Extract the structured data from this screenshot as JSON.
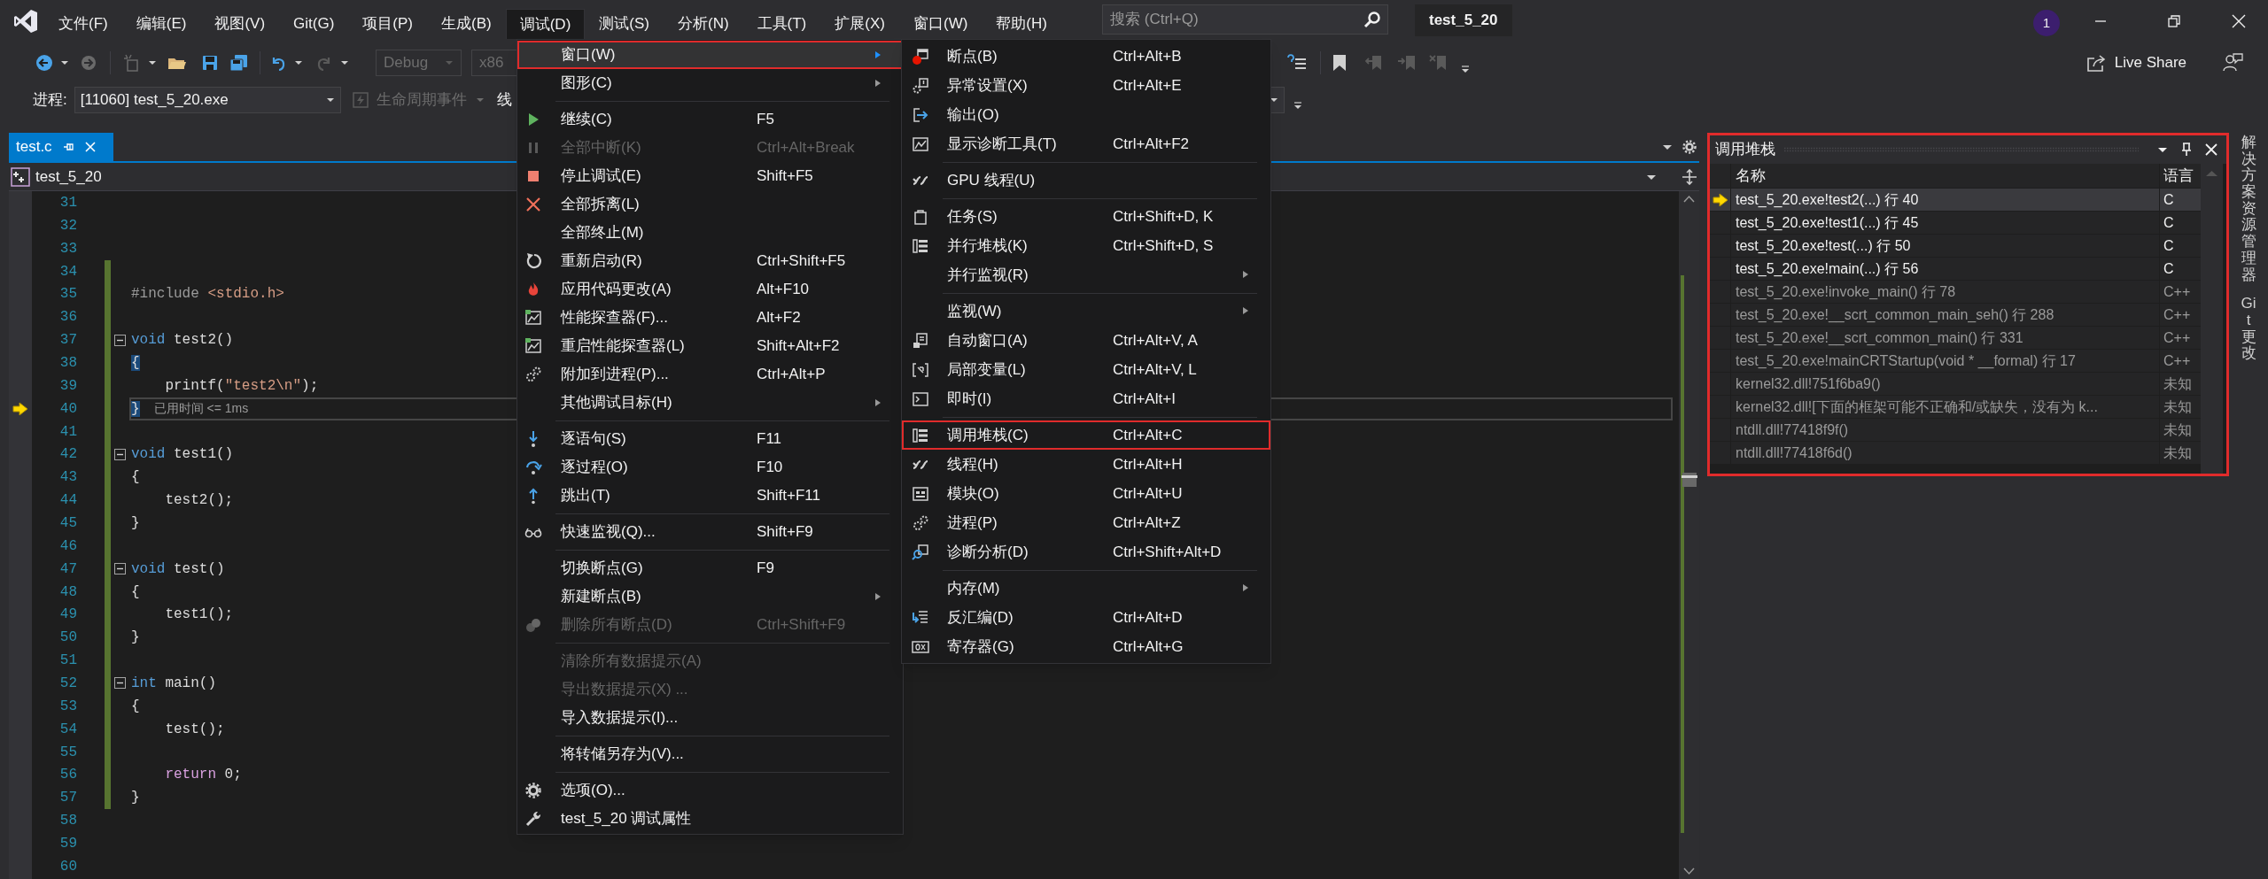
{
  "menu_bar": [
    {
      "label": "文件(F)",
      "selected": false
    },
    {
      "label": "编辑(E)",
      "selected": false
    },
    {
      "label": "视图(V)",
      "selected": false
    },
    {
      "label": "Git(G)",
      "selected": false
    },
    {
      "label": "项目(P)",
      "selected": false
    },
    {
      "label": "生成(B)",
      "selected": false
    },
    {
      "label": "调试(D)",
      "selected": true
    },
    {
      "label": "测试(S)",
      "selected": false
    },
    {
      "label": "分析(N)",
      "selected": false
    },
    {
      "label": "工具(T)",
      "selected": false
    },
    {
      "label": "扩展(X)",
      "selected": false
    },
    {
      "label": "窗口(W)",
      "selected": false
    },
    {
      "label": "帮助(H)",
      "selected": false
    }
  ],
  "search": {
    "placeholder": "搜索 (Ctrl+Q)"
  },
  "window_title": "test_5_20",
  "notification_count": "1",
  "toolbar": {
    "dropdowns": [
      {
        "value": "Debug",
        "disabled": true
      },
      {
        "value": "x86",
        "disabled": true
      }
    ],
    "live_share": "Live Share"
  },
  "process_bar": {
    "label": "进程:",
    "process": "[11060] test_5_20.exe",
    "lifecycle_events": {
      "label": "生命周期事件",
      "disabled": true
    },
    "thread_label": "线"
  },
  "document_tab": {
    "label": "test.c",
    "selected": true
  },
  "breadcrumb": "test_5_20",
  "editor": {
    "lines": [
      {
        "number": "31",
        "changed": false,
        "fold": false,
        "current": false
      },
      {
        "number": "32",
        "changed": false,
        "fold": false,
        "current": false
      },
      {
        "number": "33",
        "changed": false,
        "fold": false,
        "current": false
      },
      {
        "number": "34",
        "changed": true,
        "fold": false,
        "current": false
      },
      {
        "number": "35",
        "changed": true,
        "fold": false,
        "current": false,
        "tokens": [
          {
            "kind": "preprocessor",
            "text": "#include "
          },
          {
            "kind": "include",
            "text": "<stdio.h>"
          }
        ]
      },
      {
        "number": "36",
        "changed": true,
        "fold": false,
        "current": false
      },
      {
        "number": "37",
        "changed": true,
        "fold": true,
        "current": false,
        "tokens": [
          {
            "kind": "keyword",
            "text": "void"
          },
          {
            "kind": "plain",
            "text": " test2()"
          }
        ]
      },
      {
        "number": "38",
        "changed": true,
        "fold": false,
        "current": false,
        "tokens": [
          {
            "kind": "brace_match",
            "text": "{"
          }
        ]
      },
      {
        "number": "39",
        "changed": true,
        "fold": false,
        "current": false,
        "tokens": [
          {
            "kind": "plain",
            "text": "    printf("
          },
          {
            "kind": "string",
            "text": "\"test2\\n\""
          },
          {
            "kind": "plain",
            "text": ");"
          }
        ]
      },
      {
        "number": "40",
        "changed": true,
        "fold": false,
        "current": true,
        "tokens": [
          {
            "kind": "brace_match",
            "text": "}"
          }
        ],
        "tip": "已用时间 <= 1ms"
      },
      {
        "number": "41",
        "changed": true,
        "fold": false,
        "current": false
      },
      {
        "number": "42",
        "changed": true,
        "fold": true,
        "current": false,
        "tokens": [
          {
            "kind": "keyword",
            "text": "void"
          },
          {
            "kind": "plain",
            "text": " test1()"
          }
        ]
      },
      {
        "number": "43",
        "changed": true,
        "fold": false,
        "current": false,
        "tokens": [
          {
            "kind": "plain",
            "text": "{"
          }
        ]
      },
      {
        "number": "44",
        "changed": true,
        "fold": false,
        "current": false,
        "tokens": [
          {
            "kind": "plain",
            "text": "    test2();"
          }
        ]
      },
      {
        "number": "45",
        "changed": true,
        "fold": false,
        "current": false,
        "tokens": [
          {
            "kind": "plain",
            "text": "}"
          }
        ]
      },
      {
        "number": "46",
        "changed": true,
        "fold": false,
        "current": false
      },
      {
        "number": "47",
        "changed": true,
        "fold": true,
        "current": false,
        "tokens": [
          {
            "kind": "keyword",
            "text": "void"
          },
          {
            "kind": "plain",
            "text": " test()"
          }
        ]
      },
      {
        "number": "48",
        "changed": true,
        "fold": false,
        "current": false,
        "tokens": [
          {
            "kind": "plain",
            "text": "{"
          }
        ]
      },
      {
        "number": "49",
        "changed": true,
        "fold": false,
        "current": false,
        "tokens": [
          {
            "kind": "plain",
            "text": "    test1();"
          }
        ]
      },
      {
        "number": "50",
        "changed": true,
        "fold": false,
        "current": false,
        "tokens": [
          {
            "kind": "plain",
            "text": "}"
          }
        ]
      },
      {
        "number": "51",
        "changed": true,
        "fold": false,
        "current": false
      },
      {
        "number": "52",
        "changed": true,
        "fold": true,
        "current": false,
        "tokens": [
          {
            "kind": "keyword",
            "text": "int"
          },
          {
            "kind": "plain",
            "text": " main()"
          }
        ]
      },
      {
        "number": "53",
        "changed": true,
        "fold": false,
        "current": false,
        "tokens": [
          {
            "kind": "plain",
            "text": "{"
          }
        ]
      },
      {
        "number": "54",
        "changed": true,
        "fold": false,
        "current": false,
        "tokens": [
          {
            "kind": "plain",
            "text": "    test();"
          }
        ]
      },
      {
        "number": "55",
        "changed": true,
        "fold": false,
        "current": false
      },
      {
        "number": "56",
        "changed": true,
        "fold": false,
        "current": false,
        "tokens": [
          {
            "kind": "control",
            "text": "    return"
          },
          {
            "kind": "plain",
            "text": " 0;"
          }
        ]
      },
      {
        "number": "57",
        "changed": true,
        "fold": false,
        "current": false,
        "tokens": [
          {
            "kind": "plain",
            "text": "}"
          }
        ]
      },
      {
        "number": "58",
        "changed": false,
        "fold": false,
        "current": false
      },
      {
        "number": "59",
        "changed": false,
        "fold": false,
        "current": false
      },
      {
        "number": "60",
        "changed": false,
        "fold": false,
        "current": false
      }
    ]
  },
  "debug_menu": {
    "items": [
      {
        "kind": "item",
        "label": "窗口(W)",
        "submenu": true,
        "disabled": false,
        "selected": true,
        "highlighted": true
      },
      {
        "kind": "item",
        "label": "图形(C)",
        "submenu": true,
        "disabled": false,
        "selected": false,
        "highlighted": false
      },
      {
        "kind": "separator"
      },
      {
        "kind": "item",
        "label": "继续(C)",
        "shortcut": "F5",
        "submenu": false,
        "disabled": false,
        "selected": false,
        "highlighted": false
      },
      {
        "kind": "item",
        "label": "全部中断(K)",
        "shortcut": "Ctrl+Alt+Break",
        "submenu": false,
        "disabled": true,
        "selected": false,
        "highlighted": false
      },
      {
        "kind": "item",
        "label": "停止调试(E)",
        "shortcut": "Shift+F5",
        "submenu": false,
        "disabled": false,
        "selected": false,
        "highlighted": false
      },
      {
        "kind": "item",
        "label": "全部拆离(L)",
        "submenu": false,
        "disabled": false,
        "selected": false,
        "highlighted": false
      },
      {
        "kind": "item",
        "label": "全部终止(M)",
        "submenu": false,
        "disabled": false,
        "selected": false,
        "highlighted": false
      },
      {
        "kind": "item",
        "label": "重新启动(R)",
        "shortcut": "Ctrl+Shift+F5",
        "submenu": false,
        "disabled": false,
        "selected": false,
        "highlighted": false
      },
      {
        "kind": "item",
        "label": "应用代码更改(A)",
        "shortcut": "Alt+F10",
        "submenu": false,
        "disabled": false,
        "selected": false,
        "highlighted": false
      },
      {
        "kind": "item",
        "label": "性能探查器(F)...",
        "shortcut": "Alt+F2",
        "submenu": false,
        "disabled": false,
        "selected": false,
        "highlighted": false
      },
      {
        "kind": "item",
        "label": "重启性能探查器(L)",
        "shortcut": "Shift+Alt+F2",
        "submenu": false,
        "disabled": false,
        "selected": false,
        "highlighted": false
      },
      {
        "kind": "item",
        "label": "附加到进程(P)...",
        "shortcut": "Ctrl+Alt+P",
        "submenu": false,
        "disabled": false,
        "selected": false,
        "highlighted": false
      },
      {
        "kind": "item",
        "label": "其他调试目标(H)",
        "submenu": true,
        "disabled": false,
        "selected": false,
        "highlighted": false
      },
      {
        "kind": "separator"
      },
      {
        "kind": "item",
        "label": "逐语句(S)",
        "shortcut": "F11",
        "submenu": false,
        "disabled": false,
        "selected": false,
        "highlighted": false
      },
      {
        "kind": "item",
        "label": "逐过程(O)",
        "shortcut": "F10",
        "submenu": false,
        "disabled": false,
        "selected": false,
        "highlighted": false
      },
      {
        "kind": "item",
        "label": "跳出(T)",
        "shortcut": "Shift+F11",
        "submenu": false,
        "disabled": false,
        "selected": false,
        "highlighted": false
      },
      {
        "kind": "separator"
      },
      {
        "kind": "item",
        "label": "快速监视(Q)...",
        "shortcut": "Shift+F9",
        "submenu": false,
        "disabled": false,
        "selected": false,
        "highlighted": false
      },
      {
        "kind": "separator"
      },
      {
        "kind": "item",
        "label": "切换断点(G)",
        "shortcut": "F9",
        "submenu": false,
        "disabled": false,
        "selected": false,
        "highlighted": false
      },
      {
        "kind": "item",
        "label": "新建断点(B)",
        "submenu": true,
        "disabled": false,
        "selected": false,
        "highlighted": false
      },
      {
        "kind": "item",
        "label": "删除所有断点(D)",
        "shortcut": "Ctrl+Shift+F9",
        "submenu": false,
        "disabled": true,
        "selected": false,
        "highlighted": false
      },
      {
        "kind": "separator"
      },
      {
        "kind": "item",
        "label": "清除所有数据提示(A)",
        "submenu": false,
        "disabled": true,
        "selected": false,
        "highlighted": false
      },
      {
        "kind": "item",
        "label": "导出数据提示(X) ...",
        "submenu": false,
        "disabled": true,
        "selected": false,
        "highlighted": false
      },
      {
        "kind": "item",
        "label": "导入数据提示(I)...",
        "submenu": false,
        "disabled": false,
        "selected": false,
        "highlighted": false
      },
      {
        "kind": "separator"
      },
      {
        "kind": "item",
        "label": "将转储另存为(V)...",
        "submenu": false,
        "disabled": false,
        "selected": false,
        "highlighted": false
      },
      {
        "kind": "separator"
      },
      {
        "kind": "item",
        "label": "选项(O)...",
        "submenu": false,
        "disabled": false,
        "selected": false,
        "highlighted": false
      },
      {
        "kind": "item",
        "label": "test_5_20 调试属性",
        "submenu": false,
        "disabled": false,
        "selected": false,
        "highlighted": false
      }
    ]
  },
  "window_submenu": {
    "items": [
      {
        "kind": "item",
        "label": "断点(B)",
        "shortcut": "Ctrl+Alt+B",
        "submenu": false,
        "highlighted": false
      },
      {
        "kind": "item",
        "label": "异常设置(X)",
        "shortcut": "Ctrl+Alt+E",
        "submenu": false,
        "highlighted": false
      },
      {
        "kind": "item",
        "label": "输出(O)",
        "submenu": false,
        "highlighted": false
      },
      {
        "kind": "item",
        "label": "显示诊断工具(T)",
        "shortcut": "Ctrl+Alt+F2",
        "submenu": false,
        "highlighted": false
      },
      {
        "kind": "separator"
      },
      {
        "kind": "item",
        "label": "GPU 线程(U)",
        "submenu": false,
        "highlighted": false
      },
      {
        "kind": "separator"
      },
      {
        "kind": "item",
        "label": "任务(S)",
        "shortcut": "Ctrl+Shift+D, K",
        "submenu": false,
        "highlighted": false
      },
      {
        "kind": "item",
        "label": "并行堆栈(K)",
        "shortcut": "Ctrl+Shift+D, S",
        "submenu": false,
        "highlighted": false
      },
      {
        "kind": "item",
        "label": "并行监视(R)",
        "submenu": true,
        "highlighted": false
      },
      {
        "kind": "separator"
      },
      {
        "kind": "item",
        "label": "监视(W)",
        "submenu": true,
        "highlighted": false
      },
      {
        "kind": "item",
        "label": "自动窗口(A)",
        "shortcut": "Ctrl+Alt+V, A",
        "submenu": false,
        "highlighted": false
      },
      {
        "kind": "item",
        "label": "局部变量(L)",
        "shortcut": "Ctrl+Alt+V, L",
        "submenu": false,
        "highlighted": false
      },
      {
        "kind": "item",
        "label": "即时(I)",
        "shortcut": "Ctrl+Alt+I",
        "submenu": false,
        "highlighted": false
      },
      {
        "kind": "separator"
      },
      {
        "kind": "item",
        "label": "调用堆栈(C)",
        "shortcut": "Ctrl+Alt+C",
        "submenu": false,
        "highlighted": true
      },
      {
        "kind": "item",
        "label": "线程(H)",
        "shortcut": "Ctrl+Alt+H",
        "submenu": false,
        "highlighted": false
      },
      {
        "kind": "item",
        "label": "模块(O)",
        "shortcut": "Ctrl+Alt+U",
        "submenu": false,
        "highlighted": false
      },
      {
        "kind": "item",
        "label": "进程(P)",
        "shortcut": "Ctrl+Alt+Z",
        "submenu": false,
        "highlighted": false
      },
      {
        "kind": "item",
        "label": "诊断分析(D)",
        "shortcut": "Ctrl+Shift+Alt+D",
        "submenu": false,
        "highlighted": false
      },
      {
        "kind": "separator"
      },
      {
        "kind": "item",
        "label": "内存(M)",
        "submenu": true,
        "highlighted": false
      },
      {
        "kind": "item",
        "label": "反汇编(D)",
        "shortcut": "Ctrl+Alt+D",
        "submenu": false,
        "highlighted": false
      },
      {
        "kind": "item",
        "label": "寄存器(G)",
        "shortcut": "Ctrl+Alt+G",
        "submenu": false,
        "highlighted": false
      }
    ]
  },
  "call_stack": {
    "title": "调用堆栈",
    "highlighted": true,
    "columns": [
      "名称",
      "语言"
    ],
    "rows": [
      {
        "name": "test_5_20.exe!test2(...) 行 40",
        "language": "C",
        "current": true,
        "dimmed": false
      },
      {
        "name": "test_5_20.exe!test1(...) 行 45",
        "language": "C",
        "current": false,
        "dimmed": false
      },
      {
        "name": "test_5_20.exe!test(...) 行 50",
        "language": "C",
        "current": false,
        "dimmed": false
      },
      {
        "name": "test_5_20.exe!main(...) 行 56",
        "language": "C",
        "current": false,
        "dimmed": false
      },
      {
        "name": "test_5_20.exe!invoke_main() 行 78",
        "language": "C++",
        "current": false,
        "dimmed": true
      },
      {
        "name": "test_5_20.exe!__scrt_common_main_seh() 行 288",
        "language": "C++",
        "current": false,
        "dimmed": true
      },
      {
        "name": "test_5_20.exe!__scrt_common_main() 行 331",
        "language": "C++",
        "current": false,
        "dimmed": true
      },
      {
        "name": "test_5_20.exe!mainCRTStartup(void * __formal) 行 17",
        "language": "C++",
        "current": false,
        "dimmed": true
      },
      {
        "name": "kernel32.dll!751f6ba9()",
        "language": "未知",
        "current": false,
        "dimmed": true
      },
      {
        "name": "kernel32.dll![下面的框架可能不正确和/或缺失，没有为 k...",
        "language": "未知",
        "current": false,
        "dimmed": true
      },
      {
        "name": "ntdll.dll!77418f9f()",
        "language": "未知",
        "current": false,
        "dimmed": true
      },
      {
        "name": "ntdll.dll!77418f6d()",
        "language": "未知",
        "current": false,
        "dimmed": true
      }
    ]
  },
  "side_tabs": [
    "解决方案资源管理器",
    "Git 更改"
  ]
}
